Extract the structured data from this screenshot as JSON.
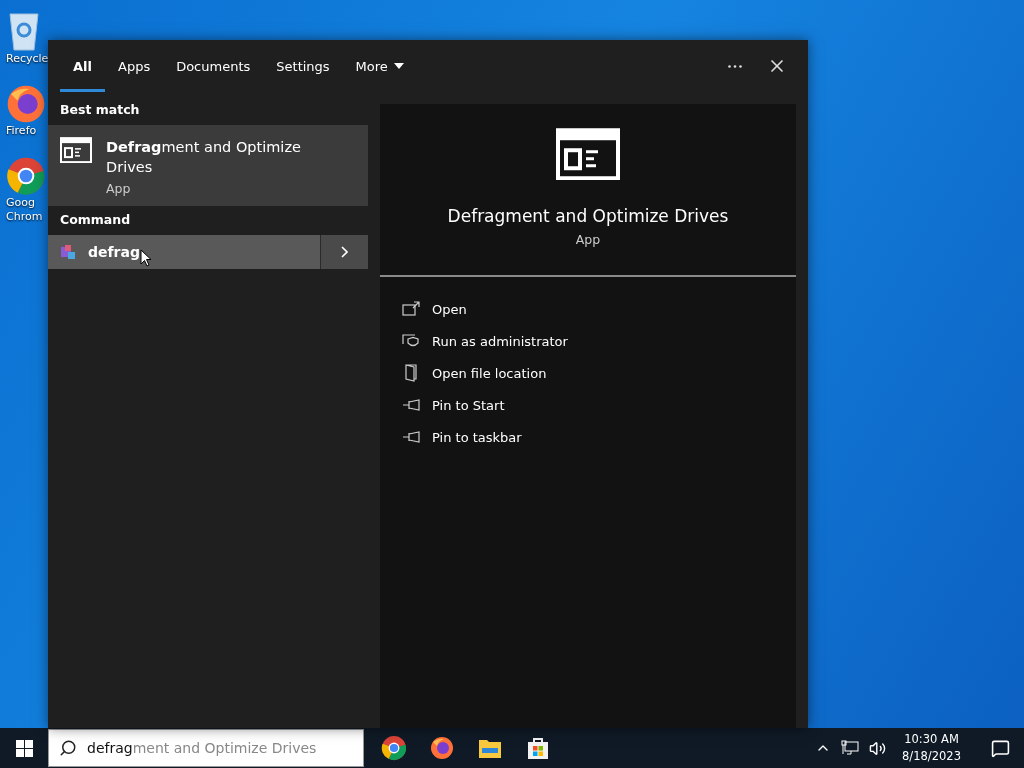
{
  "desktop_icons": [
    {
      "kind": "recycle",
      "label": "Recycle"
    },
    {
      "kind": "firefox",
      "label": "Firefo"
    },
    {
      "kind": "chrome",
      "label": [
        "Goog",
        "Chrom"
      ]
    }
  ],
  "search_panel": {
    "tabs": [
      {
        "label": "All",
        "selected": true
      },
      {
        "label": "Apps",
        "selected": false
      },
      {
        "label": "Documents",
        "selected": false
      },
      {
        "label": "Settings",
        "selected": false
      },
      {
        "label": "More",
        "selected": false,
        "dropdown": true
      }
    ],
    "sections": [
      {
        "heading": "Best match",
        "items": [
          {
            "kind": "app",
            "title": "**Defrag**ment and Optimize Drives",
            "subtitle": "App",
            "selected": true
          }
        ]
      },
      {
        "heading": "Command",
        "items": [
          {
            "kind": "command",
            "title": "defrag",
            "selected": false,
            "hovered": true
          }
        ]
      }
    ],
    "details": {
      "title": "Defragment and Optimize Drives",
      "subtitle": "App",
      "actions": [
        {
          "kind": "open",
          "label": "Open"
        },
        {
          "kind": "admin",
          "label": "Run as administrator"
        },
        {
          "kind": "folder",
          "label": "Open file location"
        },
        {
          "kind": "pin",
          "label": "Pin to Start"
        },
        {
          "kind": "pin",
          "label": "Pin to taskbar"
        }
      ]
    }
  },
  "taskbar": {
    "search": {
      "value": "defrag",
      "suggestion": "ment and Optimize Drives"
    },
    "apps": [
      {
        "kind": "chrome"
      },
      {
        "kind": "firefox"
      },
      {
        "kind": "explorer"
      },
      {
        "kind": "store"
      }
    ],
    "clock": {
      "time": "10:30 AM",
      "date": "8/18/2023"
    }
  }
}
